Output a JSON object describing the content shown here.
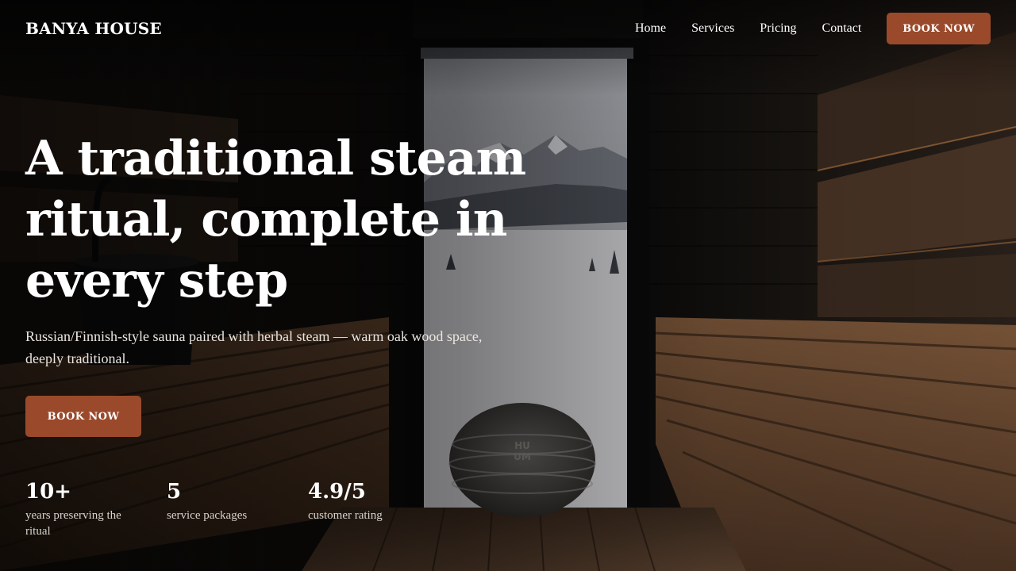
{
  "brand": {
    "name": "BANYA HOUSE"
  },
  "nav": {
    "links": [
      "Home",
      "Services",
      "Pricing",
      "Contact"
    ],
    "cta": "BOOK NOW"
  },
  "hero": {
    "headline": "A traditional steam ritual, complete in every step",
    "subtitle": "Russian/Finnish-style sauna paired with herbal steam — warm oak wood space, deeply traditional.",
    "cta": "BOOK NOW"
  },
  "stats": [
    {
      "value": "10+",
      "label": "years preserving the ritual"
    },
    {
      "value": "5",
      "label": "service packages"
    },
    {
      "value": "4.9/5",
      "label": "customer rating"
    }
  ],
  "colors": {
    "accent": "#9a4a2b",
    "background": "#0f0f10"
  },
  "stove_logo": "HUUM"
}
